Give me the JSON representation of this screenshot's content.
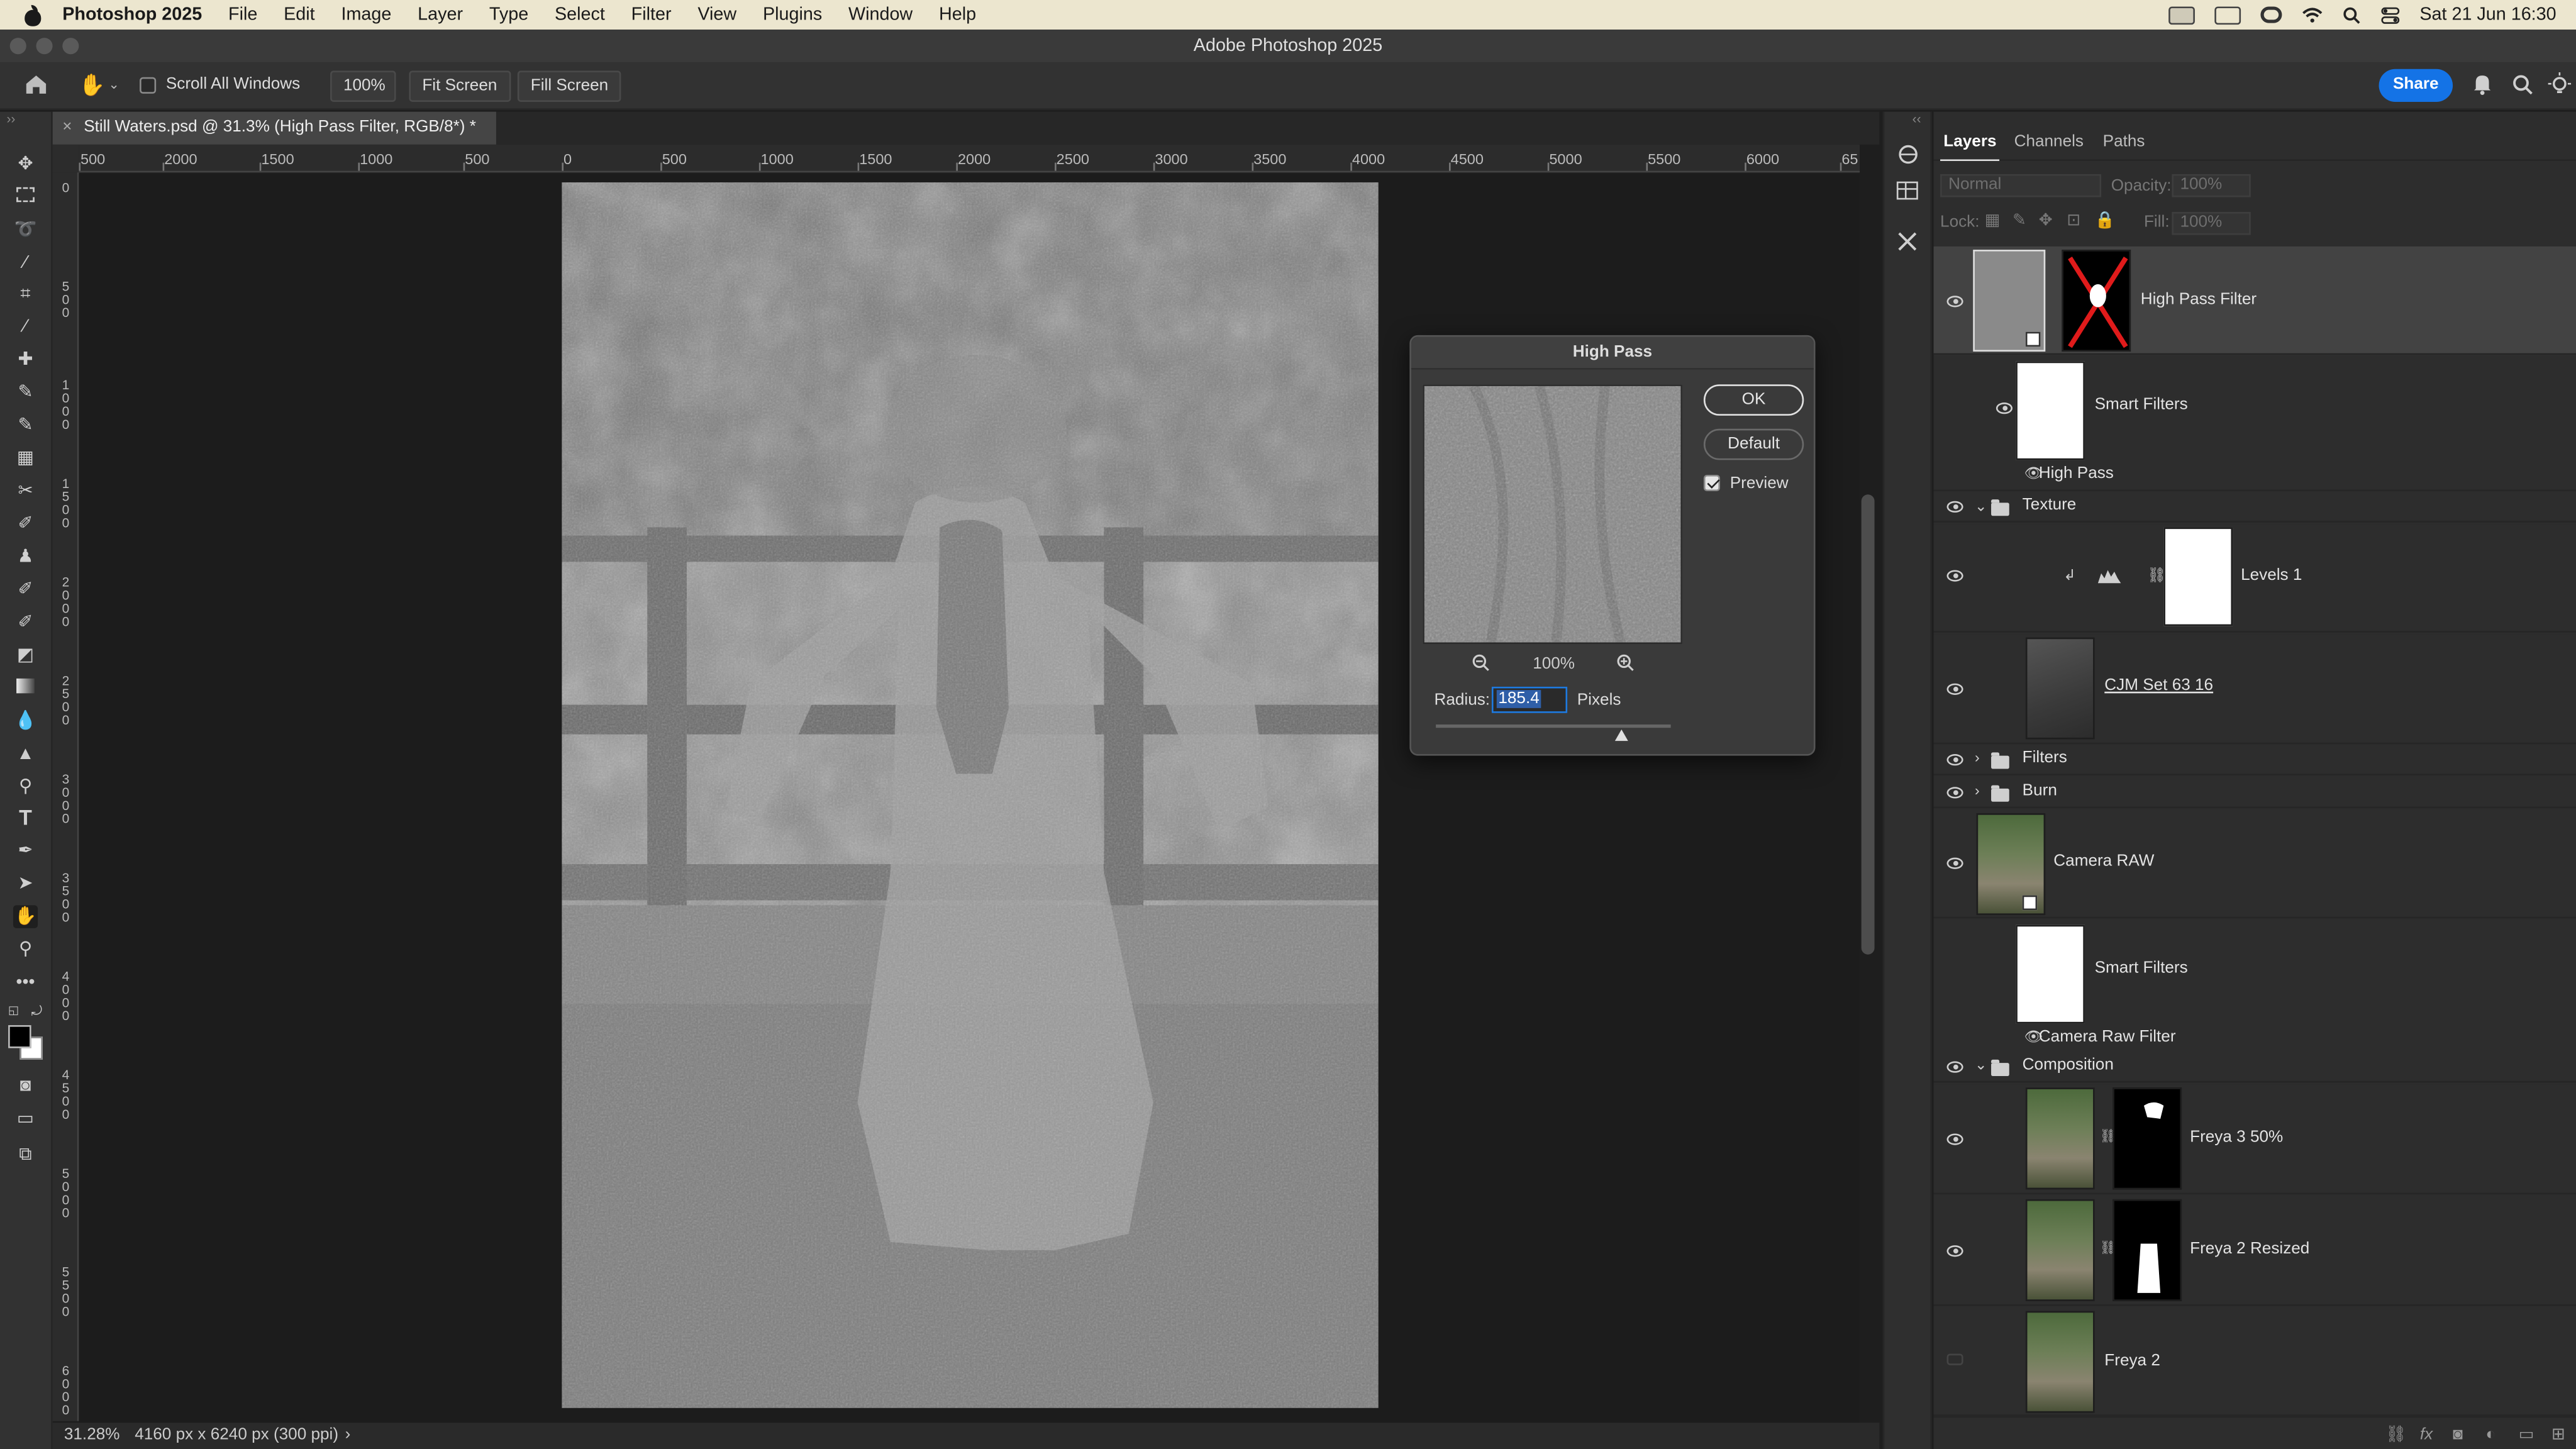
{
  "menubar": {
    "app_name": "Photoshop 2025",
    "items": [
      "File",
      "Edit",
      "Image",
      "Layer",
      "Type",
      "Select",
      "Filter",
      "View",
      "Plugins",
      "Window",
      "Help"
    ],
    "clock": "Sat 21 Jun  16:30"
  },
  "window": {
    "title": "Adobe Photoshop 2025"
  },
  "options": {
    "scroll_all_label": "Scroll All Windows",
    "zoom_value": "100%",
    "fit_screen": "Fit Screen",
    "fill_screen": "Fill Screen",
    "share": "Share"
  },
  "document": {
    "tab_title": "Still Waters.psd @ 31.3% (High Pass Filter, RGB/8*) *"
  },
  "ruler": {
    "top": [
      "500",
      "2000",
      "1500",
      "1000",
      "500",
      "0",
      "500",
      "1000",
      "1500",
      "2000",
      "2500",
      "3000",
      "3500",
      "4000",
      "4500",
      "5000",
      "5500",
      "6000",
      "65"
    ],
    "left": [
      "0",
      "500",
      "1000",
      "1500",
      "2000",
      "2500",
      "3000",
      "3500",
      "4000",
      "4500",
      "5000",
      "5500",
      "6000"
    ]
  },
  "status": {
    "zoom": "31.28%",
    "info": "4160 px x 6240 px (300 ppi)",
    "arrow": "›"
  },
  "dialog": {
    "title": "High Pass",
    "ok": "OK",
    "default": "Default",
    "preview_label": "Preview",
    "preview_checked": true,
    "preview_zoom": "100%",
    "radius_label": "Radius:",
    "radius_value": "185.4",
    "radius_unit": "Pixels"
  },
  "panel": {
    "tabs": [
      "Layers",
      "Channels",
      "Paths"
    ],
    "blend_mode": "Normal",
    "opacity_label": "Opacity:",
    "opacity_value": "100%",
    "lock_label": "Lock:",
    "fill_label": "Fill:",
    "fill_value": "100%",
    "layers": {
      "high_pass_filter": "High Pass Filter",
      "smart_filters_1": "Smart Filters",
      "high_pass": "High Pass",
      "texture": "Texture",
      "levels": "Levels 1",
      "cjm": "CJM Set 63 16",
      "filters": "Filters",
      "burn": "Burn",
      "camera_raw": "Camera RAW",
      "smart_filters_2": "Smart Filters",
      "camera_raw_filter": "Camera Raw Filter",
      "composition": "Composition",
      "freya3": "Freya 3 50%",
      "freya2_resized": "Freya 2 Resized",
      "freya2": "Freya 2"
    }
  },
  "colors": {
    "accent": "#1473e6",
    "menubar_bg": "#ece6cf",
    "panel_bg": "#2d2d2d"
  }
}
